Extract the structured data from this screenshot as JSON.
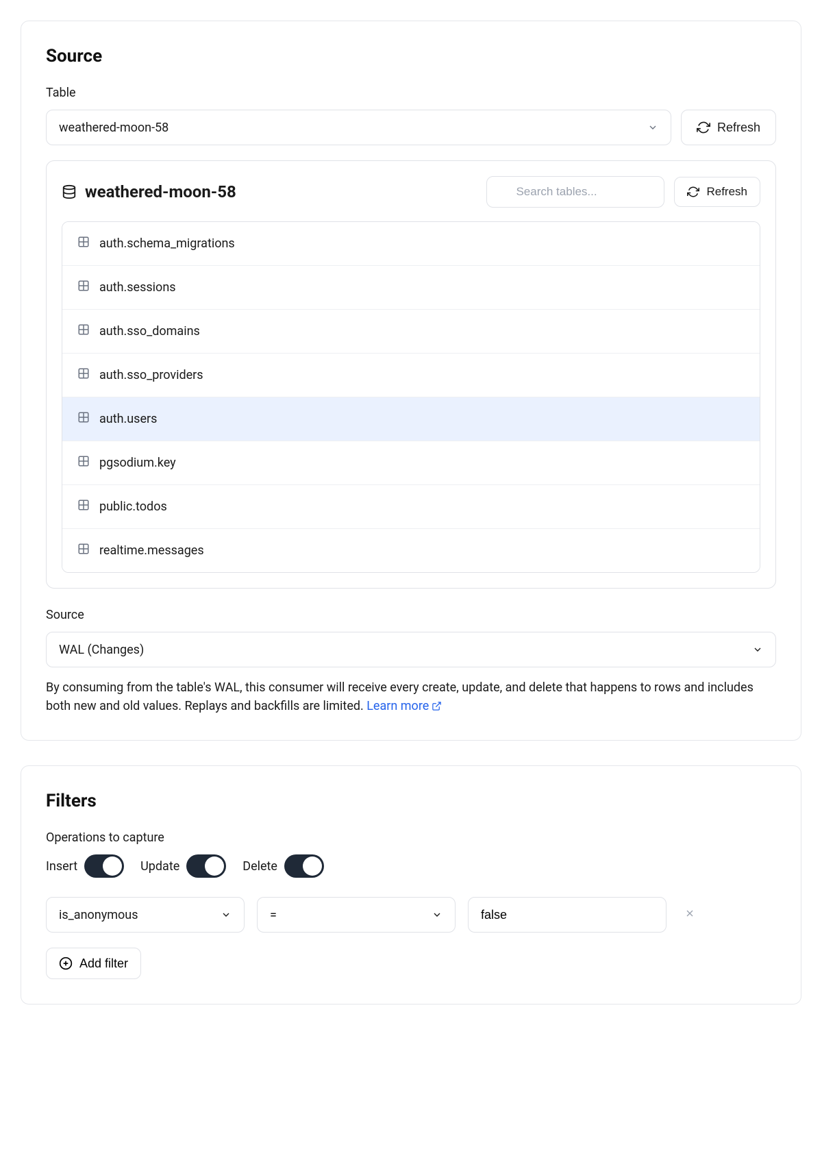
{
  "source_card": {
    "title": "Source",
    "table_label": "Table",
    "table_select_value": "weathered-moon-58",
    "refresh_label": "Refresh",
    "db_name": "weathered-moon-58",
    "search_placeholder": "Search tables...",
    "inner_refresh_label": "Refresh",
    "tables": [
      {
        "name": "auth.schema_migrations",
        "selected": false
      },
      {
        "name": "auth.sessions",
        "selected": false
      },
      {
        "name": "auth.sso_domains",
        "selected": false
      },
      {
        "name": "auth.sso_providers",
        "selected": false
      },
      {
        "name": "auth.users",
        "selected": true
      },
      {
        "name": "pgsodium.key",
        "selected": false
      },
      {
        "name": "public.todos",
        "selected": false
      },
      {
        "name": "realtime.messages",
        "selected": false
      }
    ],
    "source_section_label": "Source",
    "source_mode_value": "WAL (Changes)",
    "description_text": "By consuming from the table's WAL, this consumer will receive every create, update, and delete that happens to rows and includes both new and old values. Replays and backfills are limited. ",
    "learn_more_label": "Learn more"
  },
  "filters_card": {
    "title": "Filters",
    "operations_label": "Operations to capture",
    "toggles": {
      "insert_label": "Insert",
      "update_label": "Update",
      "delete_label": "Delete"
    },
    "filter_row": {
      "column_value": "is_anonymous",
      "operator_value": "=",
      "value_value": "false"
    },
    "add_filter_label": "Add filter"
  }
}
